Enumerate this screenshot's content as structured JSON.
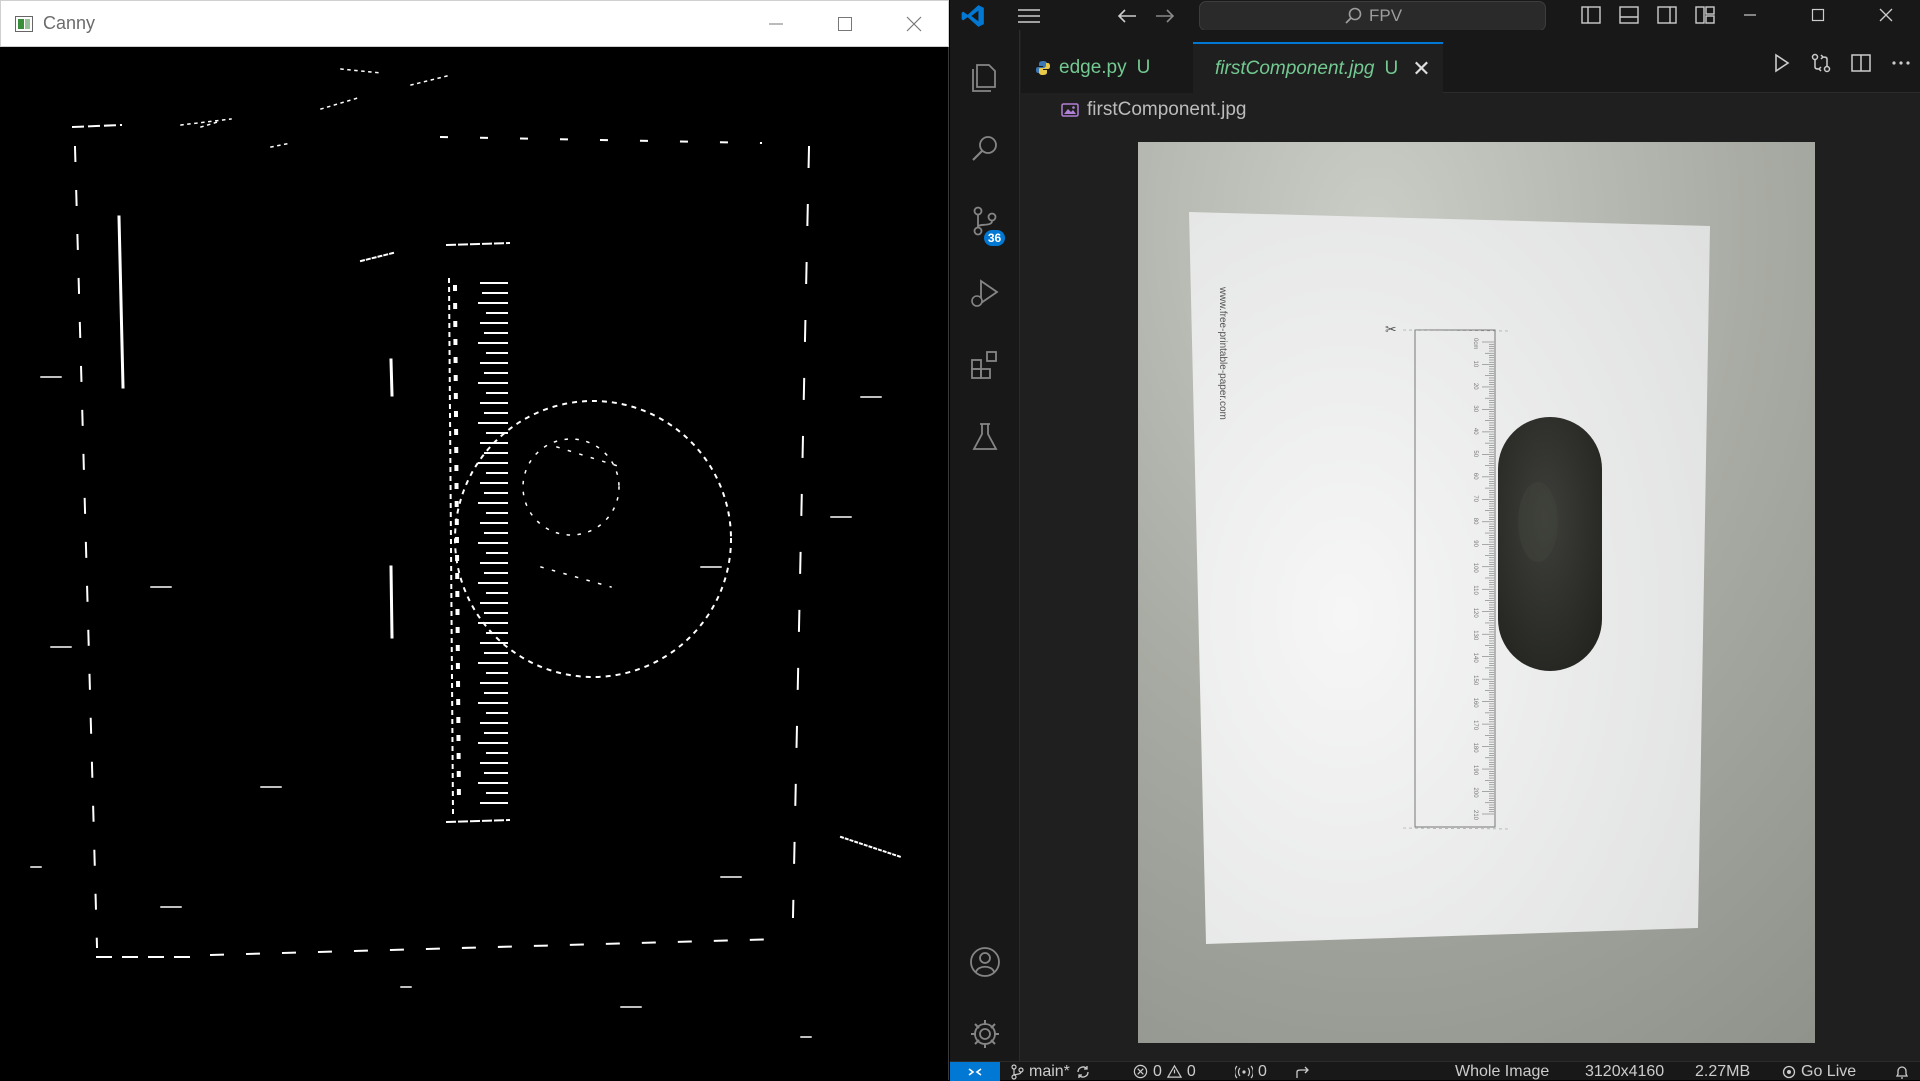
{
  "canny_window": {
    "title": "Canny"
  },
  "vscode": {
    "command_center": {
      "label": "FPV"
    },
    "source_control_badge": "36",
    "tabs": [
      {
        "label": "edge.py",
        "status": "U",
        "icon": "python-file-icon"
      },
      {
        "label": "firstComponent.jpg",
        "status": "U",
        "icon": "image-file-icon",
        "active": true
      }
    ],
    "breadcrumb": {
      "label": "firstComponent.jpg"
    },
    "image_preview": {
      "watermark": "www.free-printable-paper.com",
      "ruler_labels": [
        "0cm",
        "10",
        "20",
        "30",
        "40",
        "50",
        "60",
        "70",
        "80",
        "90",
        "100",
        "110",
        "120",
        "130",
        "140",
        "150",
        "160",
        "170",
        "180",
        "190",
        "200",
        "210"
      ]
    },
    "statusbar": {
      "branch": "main*",
      "errors": "0",
      "warnings": "0",
      "ports": "0",
      "zoom": "Whole Image",
      "dimensions": "3120x4160",
      "size": "2.27MB",
      "golive": "Go Live"
    },
    "colors": {
      "accent": "#0078d4",
      "untracked_green": "#73c991",
      "titlebar_bg": "#181818",
      "editor_bg": "#1f1f1f"
    }
  }
}
